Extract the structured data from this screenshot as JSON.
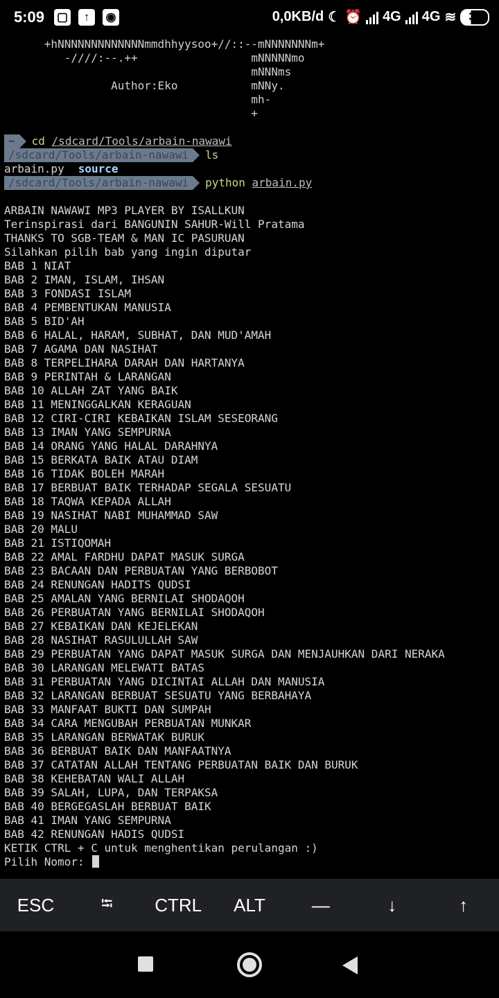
{
  "status_bar": {
    "time": "5:09",
    "left_icons": [
      "screenshot-icon",
      "upload-icon",
      "record-icon"
    ],
    "speed": "0,0KB/d",
    "net1": "4G",
    "net2": "4G",
    "battery": "36"
  },
  "terminal": {
    "banner": [
      "      +hNNNNNNNNNNNNNmmdhhyysoo+//::--mNNNNNNNm+",
      "         -////:--.++                 mNNNNNmo",
      "                                     mNNNms",
      "                Author:Eko           mNNy.",
      "                                     mh-",
      "                                     +"
    ],
    "prompt_home": "~",
    "cmd1": "cd",
    "cmd1_arg": "/sdcard/Tools/arbain-nawawi",
    "prompt_path": "/sdcard/Tools/arbain-nawawi",
    "cmd2": "ls",
    "ls_file": "arbain.py",
    "ls_dir": "source",
    "cmd3": "python",
    "cmd3_arg": "arbain.py",
    "output": [
      "ARBAIN NAWAWI MP3 PLAYER BY ISALLKUN",
      "Terinspirasi dari BANGUNIN SAHUR-Will Pratama",
      "THANKS TO SGB-TEAM & MAN IC PASURUAN",
      "Silahkan pilih bab yang ingin diputar",
      "BAB 1 NIAT",
      "BAB 2 IMAN, ISLAM, IHSAN",
      "BAB 3 FONDASI ISLAM",
      "BAB 4 PEMBENTUKAN MANUSIA",
      "BAB 5 BID'AH",
      "BAB 6 HALAL, HARAM, SUBHAT, DAN MUD'AMAH",
      "BAB 7 AGAMA DAN NASIHAT",
      "BAB 8 TERPELIHARA DARAH DAN HARTANYA",
      "BAB 9 PERINTAH & LARANGAN",
      "BAB 10 ALLAH ZAT YANG BAIK",
      "BAB 11 MENINGGALKAN KERAGUAN",
      "BAB 12 CIRI-CIRI KEBAIKAN ISLAM SESEORANG",
      "BAB 13 IMAN YANG SEMPURNA",
      "BAB 14 ORANG YANG HALAL DARAHNYA",
      "BAB 15 BERKATA BAIK ATAU DIAM",
      "BAB 16 TIDAK BOLEH MARAH",
      "BAB 17 BERBUAT BAIK TERHADAP SEGALA SESUATU",
      "BAB 18 TAQWA KEPADA ALLAH",
      "BAB 19 NASIHAT NABI MUHAMMAD SAW",
      "BAB 20 MALU",
      "BAB 21 ISTIQOMAH",
      "BAB 22 AMAL FARDHU DAPAT MASUK SURGA",
      "BAB 23 BACAAN DAN PERBUATAN YANG BERBOBOT",
      "BAB 24 RENUNGAN HADITS QUDSI",
      "BAB 25 AMALAN YANG BERNILAI SHODAQOH",
      "BAB 26 PERBUATAN YANG BERNILAI SHODAQOH",
      "BAB 27 KEBAIKAN DAN KEJELEKAN",
      "BAB 28 NASIHAT RASULULLAH SAW",
      "BAB 29 PERBUATAN YANG DAPAT MASUK SURGA DAN MENJAUHKAN DARI NERAKA",
      "BAB 30 LARANGAN MELEWATI BATAS",
      "BAB 31 PERBUATAN YANG DICINTAI ALLAH DAN MANUSIA",
      "BAB 32 LARANGAN BERBUAT SESUATU YANG BERBAHAYA",
      "BAB 33 MANFAAT BUKTI DAN SUMPAH",
      "BAB 34 CARA MENGUBAH PERBUATAN MUNKAR",
      "BAB 35 LARANGAN BERWATAK BURUK",
      "BAB 36 BERBUAT BAIK DAN MANFAATNYA",
      "BAB 37 CATATAN ALLAH TENTANG PERBUATAN BAIK DAN BURUK",
      "BAB 38 KEHEBATAN WALI ALLAH",
      "BAB 39 SALAH, LUPA, DAN TERPAKSA",
      "BAB 40 BERGEGASLAH BERBUAT BAIK",
      "BAB 41 IMAN YANG SEMPURNA",
      "BAB 42 RENUNGAN HADIS QUDSI",
      "KETIK CTRL + C untuk menghentikan perulangan :)"
    ],
    "input_prompt": "Pilih Nomor: "
  },
  "extra_keys": [
    "ESC",
    "⭾",
    "CTRL",
    "ALT",
    "—",
    "↓",
    "↑"
  ],
  "nav": {
    "icons": [
      "recents-icon",
      "home-icon",
      "back-icon"
    ]
  }
}
